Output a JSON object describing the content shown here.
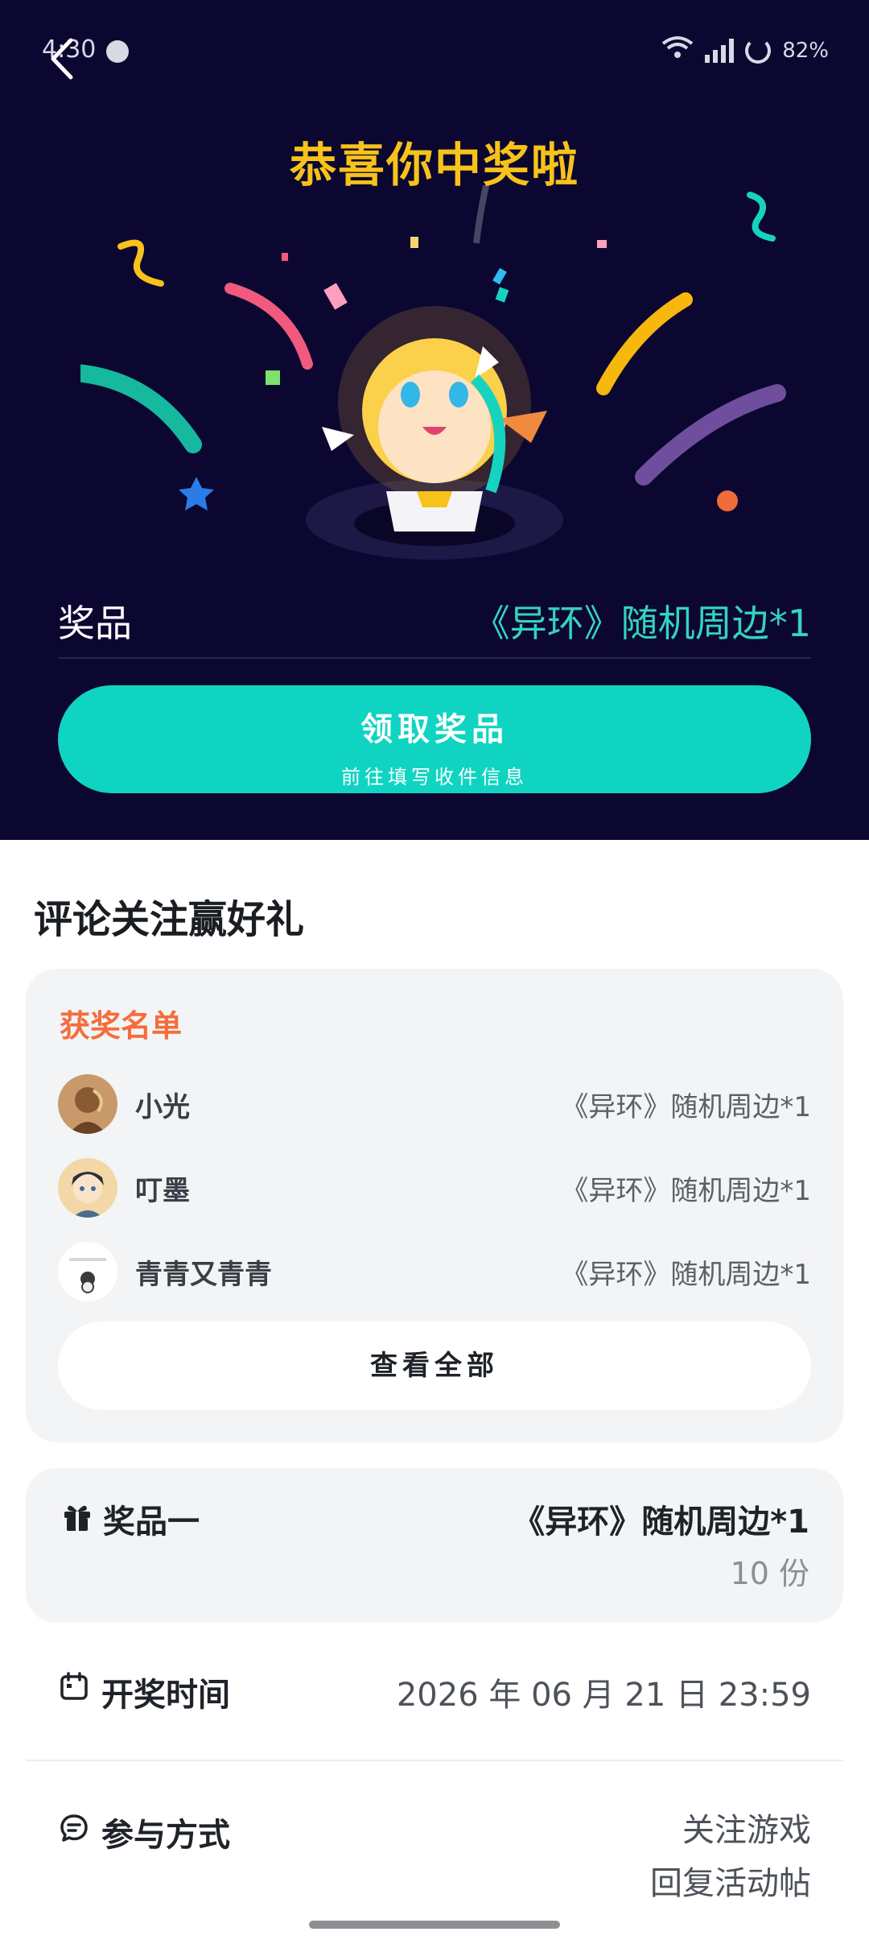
{
  "status_bar": {
    "time": "4:30",
    "battery": "82%"
  },
  "hero": {
    "title": "恭喜你中奖啦",
    "prize_label": "奖品",
    "prize_value": "《异环》随机周边*1",
    "claim_button": {
      "title": "领取奖品",
      "subtitle": "前往填写收件信息"
    }
  },
  "section": {
    "title": "评论关注赢好礼"
  },
  "winners": {
    "heading": "获奖名单",
    "items": [
      {
        "name": "小光",
        "prize": "《异环》随机周边*1"
      },
      {
        "name": "叮墨",
        "prize": "《异环》随机周边*1"
      },
      {
        "name": "青青又青青",
        "prize": "《异环》随机周边*1"
      }
    ],
    "view_all": "查看全部"
  },
  "prize_info": {
    "label": "奖品一",
    "name": "《异环》随机周边*1",
    "count": "10 份"
  },
  "draw_time": {
    "label": "开奖时间",
    "value": "2026 年 06 月 21 日 23:59"
  },
  "participation": {
    "label": "参与方式",
    "lines": [
      "关注游戏",
      "回复活动帖"
    ]
  },
  "colors": {
    "hero_bg": "#0b0730",
    "accent": "#0fd4c2",
    "title_gold": "#f7c21a",
    "winners_orange": "#f46d3b"
  }
}
